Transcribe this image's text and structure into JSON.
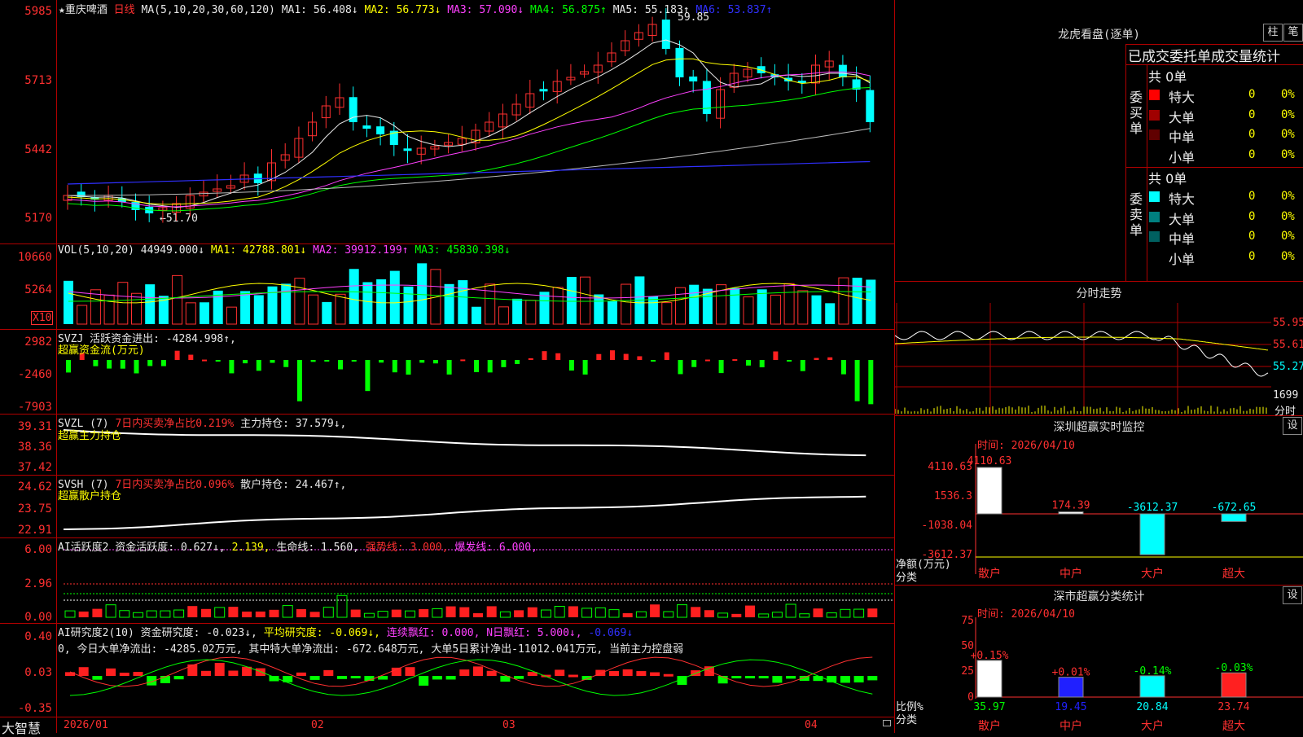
{
  "stock": {
    "name": "★重庆啤酒",
    "period": "日线",
    "ma_label": "MA(5,10,20,30,60,120)",
    "ma": [
      {
        "t": "MA1: 56.408↓",
        "c": "#e8e8e8"
      },
      {
        "t": "MA2: 56.773↓",
        "c": "#ffff00"
      },
      {
        "t": "MA3: 57.090↓",
        "c": "#ff40ff"
      },
      {
        "t": "MA4: 56.875↑",
        "c": "#00ff00"
      },
      {
        "t": "MA5: 55.183↑",
        "c": "#e8e8e8"
      },
      {
        "t": "MA6: 53.837↑",
        "c": "#3030ff"
      }
    ],
    "high_note": "59.85",
    "low_note": "←51.70"
  },
  "price_axis": [
    "5985",
    "5713",
    "5442",
    "5170"
  ],
  "vol": {
    "label": "VOL(5,10,20)",
    "val": "44949.000↓",
    "ma1": "MA1: 42788.801↓",
    "ma2": "MA2: 39912.199↑",
    "ma3": "MA3: 45830.398↓",
    "axis": [
      "10660",
      "5264"
    ],
    "unit": "X10"
  },
  "svzj": {
    "label": "SVZJ  活跃资金进出: -4284.998↑,",
    "sub": "超赢资金流(万元)",
    "axis": [
      "2982",
      "-2460",
      "-7903"
    ]
  },
  "svzl": {
    "label": "SVZL (7)",
    "l2": "7日内买卖净占比0.219%",
    "l3": "主力持仓: 37.579↓,",
    "sub": "超赢主力持仓",
    "axis": [
      "39.31",
      "38.36",
      "37.42"
    ]
  },
  "svsh": {
    "label": "SVSH (7)",
    "l2": "7日内买卖净占比0.096%",
    "l3": "散户持仓: 24.467↑,",
    "sub": "超赢散户持仓",
    "axis": [
      "24.62",
      "23.75",
      "22.91"
    ]
  },
  "ai1": {
    "label": "AI活跃度2 资金活跃度: 0.627↓,",
    "v2": "2.139,",
    "v3": "生命线: 1.560,",
    "v4": "强势线: 3.000,",
    "v5": "爆发线: 6.000,",
    "axis": [
      "6.00",
      "2.96",
      "0.00"
    ]
  },
  "ai2": {
    "label": "AI研究度2(10) 资金研究度: -0.023↓,",
    "v2": "平均研究度: -0.069↓,",
    "v3": "连续飘红: 0.000,",
    "v4": "N日飘红: 5.000↓,",
    "v5": "-0.069↓",
    "note": "0, 今日大单净流出: -4285.02万元, 其中特大单净流出: -672.648万元, 大单5日累计净出-11012.041万元, 当前主力控盘弱",
    "axis": [
      "0.40",
      "0.03",
      "-0.35"
    ]
  },
  "xaxis": {
    "brand": "大智慧",
    "dates": [
      "2026/01",
      "02",
      "03",
      "04"
    ]
  },
  "longhu": {
    "title": "龙虎看盘(逐单)",
    "btn1": "柱",
    "btn2": "笔",
    "header": "已成交委托单成交量统计",
    "buy": {
      "side": "委买单",
      "total": "共 0单",
      "rows": [
        {
          "name": "特大",
          "v": "0",
          "p": "0%",
          "c": "#ff0000"
        },
        {
          "name": "大单",
          "v": "0",
          "p": "0%",
          "c": "#a00000"
        },
        {
          "name": "中单",
          "v": "0",
          "p": "0%",
          "c": "#600000"
        },
        {
          "name": "小单",
          "v": "0",
          "p": "0%",
          "c": "#000000"
        }
      ]
    },
    "sell": {
      "side": "委卖单",
      "total": "共 0单",
      "rows": [
        {
          "name": "特大",
          "v": "0",
          "p": "0%",
          "c": "#00ffff"
        },
        {
          "name": "大单",
          "v": "0",
          "p": "0%",
          "c": "#008080"
        },
        {
          "name": "中单",
          "v": "0",
          "p": "0%",
          "c": "#006060"
        },
        {
          "name": "小单",
          "v": "0",
          "p": "0%",
          "c": "#000000"
        }
      ]
    }
  },
  "intraday": {
    "title": "分时走势",
    "axis": [
      "55.95",
      "55.61",
      "55.27"
    ],
    "vol": "1699",
    "unit": "分时"
  },
  "monitor": {
    "title": "深圳超赢实时监控",
    "btn": "设",
    "time": "时间: 2026/04/10",
    "axis": [
      "4110.63",
      "1536.3",
      "-1038.04",
      "-3612.37"
    ],
    "ylabel": "净额(万元)",
    "xlabel": "分类",
    "bars": [
      {
        "cat": "散户",
        "val": 4110.63,
        "label": "4110.63"
      },
      {
        "cat": "中户",
        "val": 174.39,
        "label": "174.39"
      },
      {
        "cat": "大户",
        "val": -3612.37,
        "label": "-3612.37"
      },
      {
        "cat": "超大",
        "val": -672.65,
        "label": "-672.65"
      }
    ]
  },
  "classify": {
    "title": "深市超赢分类统计",
    "btn": "设",
    "time": "时间: 2026/04/10",
    "axis": [
      "75",
      "50",
      "25",
      "0"
    ],
    "ylabel": "比例%",
    "xlabel": "分类",
    "bars": [
      {
        "cat": "散户",
        "val": 35.97,
        "chg": "+0.15%",
        "color": "#ffffff"
      },
      {
        "cat": "中户",
        "val": 19.45,
        "chg": "+0.01%",
        "color": "#2020ff"
      },
      {
        "cat": "大户",
        "val": 20.84,
        "chg": "-0.14%",
        "color": "#00ffff"
      },
      {
        "cat": "超大",
        "val": 23.74,
        "chg": "-0.03%",
        "color": "#ff2020"
      }
    ]
  }
}
